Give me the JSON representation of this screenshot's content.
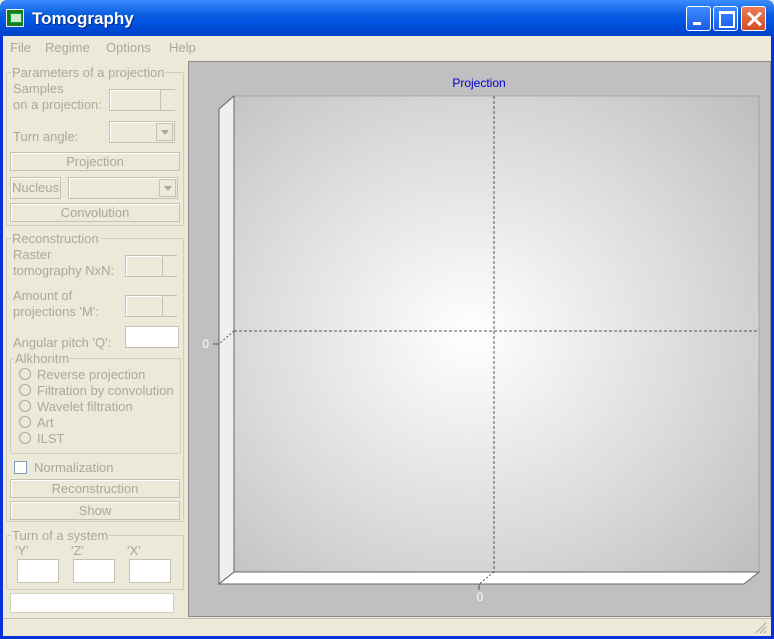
{
  "window": {
    "title": "Tomography"
  },
  "menu": [
    "File",
    "Regime",
    "Options",
    "Help"
  ],
  "projection_group": {
    "title": "Parameters of a projection",
    "samples_label_1": "Samples",
    "samples_label_2": "on a projection:",
    "samples_value": "",
    "turn_angle_label": "Turn angle:",
    "turn_angle_value": "",
    "projection_button": "Projection",
    "nucleus_button": "Nucleus",
    "nucleus_value": "",
    "convolution_button": "Convolution"
  },
  "reconstruction_group": {
    "title": "Reconstruction",
    "raster_label_1": "Raster",
    "raster_label_2": "tomography NxN:",
    "raster_value": "",
    "amount_label_1": "Amount of",
    "amount_label_2": "projections 'M':",
    "amount_value": "",
    "pitch_label": "Angular pitch 'Q':",
    "pitch_value": "",
    "algorithm": {
      "title": "Alkhoritm",
      "options": [
        "Reverse projection",
        "Filtration by convolution",
        "Wavelet filtration",
        "Art",
        "ILST"
      ]
    },
    "normalization_label": "Normalization",
    "reconstruction_button": "Reconstruction",
    "show_button": "Show"
  },
  "system_group": {
    "title": "Turn of a system",
    "y_label": "'Y'",
    "z_label": "'Z'",
    "x_label": "'X'",
    "y_value": "",
    "z_value": "",
    "x_value": ""
  },
  "status_text": "",
  "chart_data": {
    "type": "line",
    "title": "Projection",
    "series": [],
    "x_tick_labels": [
      "0"
    ],
    "y_tick_labels": [
      "0"
    ],
    "grid": true,
    "title_color": "#0000cc"
  }
}
